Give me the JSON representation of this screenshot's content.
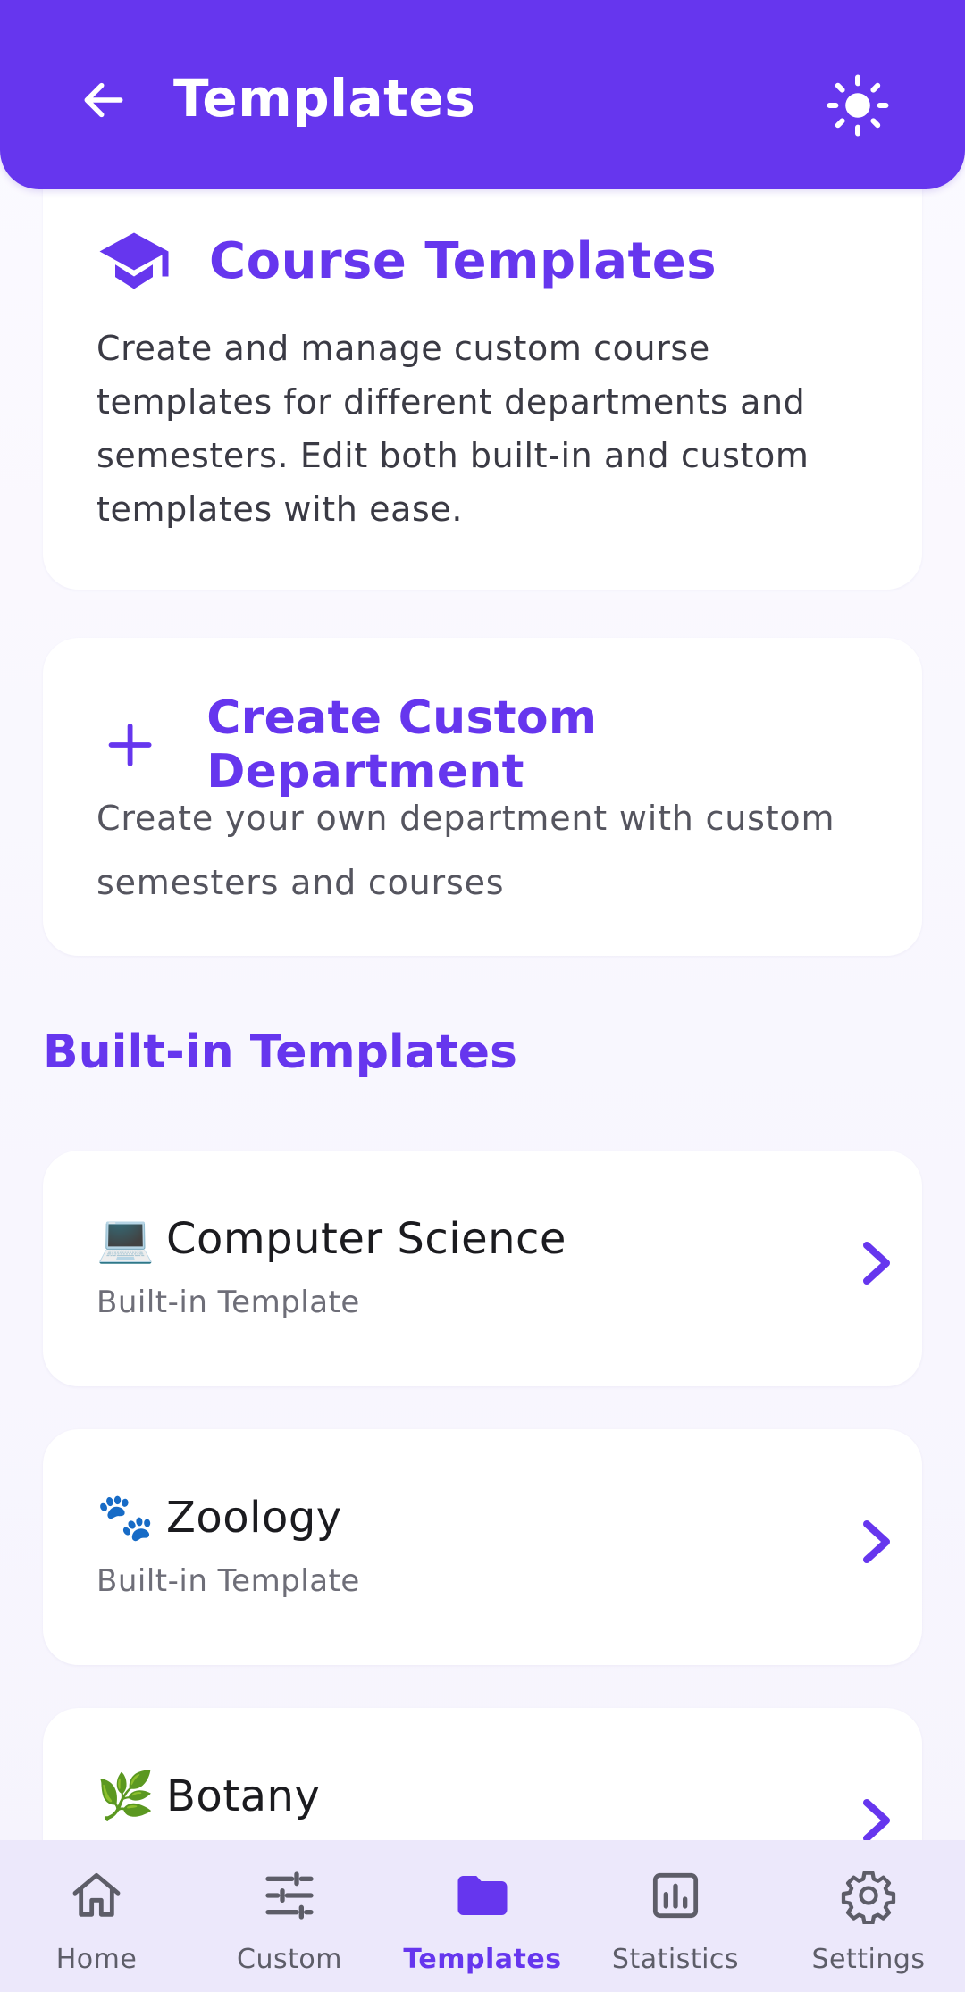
{
  "appbar": {
    "title": "Templates",
    "back_icon": "arrow-left-icon",
    "theme_icon": "sun-icon"
  },
  "intro": {
    "icon": "graduation-cap-icon",
    "title": "Course Templates",
    "description": "Create and manage custom course templates for different departments and semesters. Edit both built-in and custom templates with ease."
  },
  "create": {
    "icon": "plus-icon",
    "title": "Create Custom Department",
    "description": "Create your own department with custom semesters and courses"
  },
  "builtin": {
    "section_title": "Built-in Templates",
    "items": [
      {
        "emoji": "💻",
        "name": "Computer Science",
        "subtitle": "Built-in Template"
      },
      {
        "emoji": "🐾",
        "name": "Zoology",
        "subtitle": "Built-in Template"
      },
      {
        "emoji": "🌿",
        "name": "Botany",
        "subtitle": ""
      }
    ]
  },
  "nav": {
    "items": [
      {
        "label": "Home",
        "icon": "home-icon"
      },
      {
        "label": "Custom",
        "icon": "sliders-icon"
      },
      {
        "label": "Templates",
        "icon": "folder-icon"
      },
      {
        "label": "Statistics",
        "icon": "bar-chart-icon"
      },
      {
        "label": "Settings",
        "icon": "gear-icon"
      }
    ],
    "active": "Templates"
  },
  "colors": {
    "primary": "#6636ee",
    "nav_background": "#ece8fb",
    "surface": "#ffffff"
  }
}
